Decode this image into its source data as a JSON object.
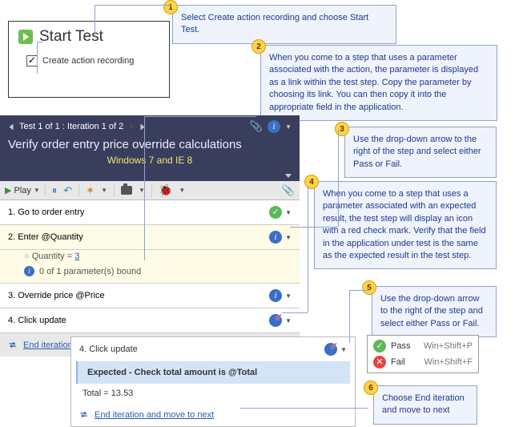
{
  "callouts": {
    "c1": "Select Create action recording and choose Start Test.",
    "c2": "When you come to a step that uses a parameter associated with the action, the parameter is displayed as a link within the test step. Copy the parameter by choosing its link. You can then copy it into the appropriate field in the application.",
    "c3": "Use the drop-down arrow to the right of the step and select either Pass or Fail.",
    "c4": "When you come to a step that uses a parameter associated with an expected result, the test step will display an icon with a red check mark. Verify that the field in the application under test is the same as the expected result in the test step.",
    "c5": "Use the drop-down arrow to the right of the step and select either Pass or Fail.",
    "c6": "Choose End iteration and move to next"
  },
  "start": {
    "title": "Start Test",
    "check": "Create action recording"
  },
  "runner": {
    "iterLabel": "Test 1 of 1 : Iteration 1 of 2",
    "title": "Verify order entry price override calculations",
    "env": "Windows 7 and IE 8",
    "playLabel": "Play",
    "steps": {
      "s1": "1. Go to order entry",
      "s2": "2. Enter @Quantity",
      "s2qLabel": "Quantity = ",
      "s2qVal": "3",
      "s2bound": "0 of 1 parameter(s) bound",
      "s3": "3. Override price @Price",
      "s4": "4. Click update"
    },
    "endLink": "End iteration and move to next"
  },
  "detail": {
    "stepLabel": "4. Click update",
    "expected": "Expected - Check total amount is @Total",
    "total": "Total = 13.53",
    "endLink": "End iteration and move to next"
  },
  "passfail": {
    "pass": "Pass",
    "passKey": "Win+Shift+P",
    "fail": "Fail",
    "failKey": "Win+Shift+F"
  }
}
